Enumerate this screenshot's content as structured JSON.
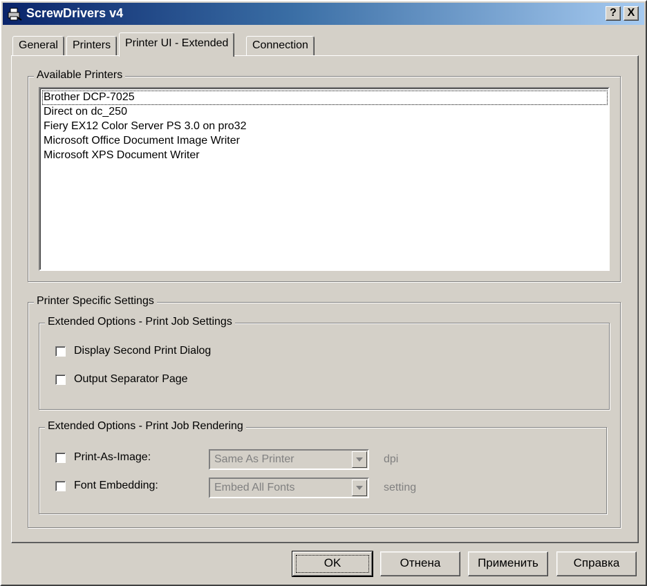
{
  "window": {
    "title": "ScrewDrivers v4",
    "help_button": "?",
    "close_button": "X"
  },
  "tabs": [
    {
      "label": "General"
    },
    {
      "label": "Printers"
    },
    {
      "label": "Printer UI - Extended"
    },
    {
      "label": "Connection"
    }
  ],
  "available_printers": {
    "label": "Available Printers",
    "items": [
      "Brother DCP-7025",
      "Direct on dc_250",
      "Fiery EX12 Color Server PS 3.0 on pro32",
      "Microsoft Office Document Image Writer",
      "Microsoft XPS Document Writer"
    ]
  },
  "printer_specific": {
    "label": "Printer Specific Settings",
    "job_settings": {
      "label": "Extended Options - Print Job Settings",
      "display_second_dialog": "Display Second Print Dialog",
      "output_separator": "Output Separator Page"
    },
    "job_rendering": {
      "label": "Extended Options - Print Job Rendering",
      "print_as_image": {
        "label": "Print-As-Image:",
        "value": "Same As Printer",
        "unit": "dpi"
      },
      "font_embedding": {
        "label": "Font Embedding:",
        "value": "Embed All Fonts",
        "unit": "setting"
      }
    }
  },
  "buttons": {
    "ok": "OK",
    "cancel": "Отнена",
    "apply": "Применить",
    "help": "Справка"
  }
}
